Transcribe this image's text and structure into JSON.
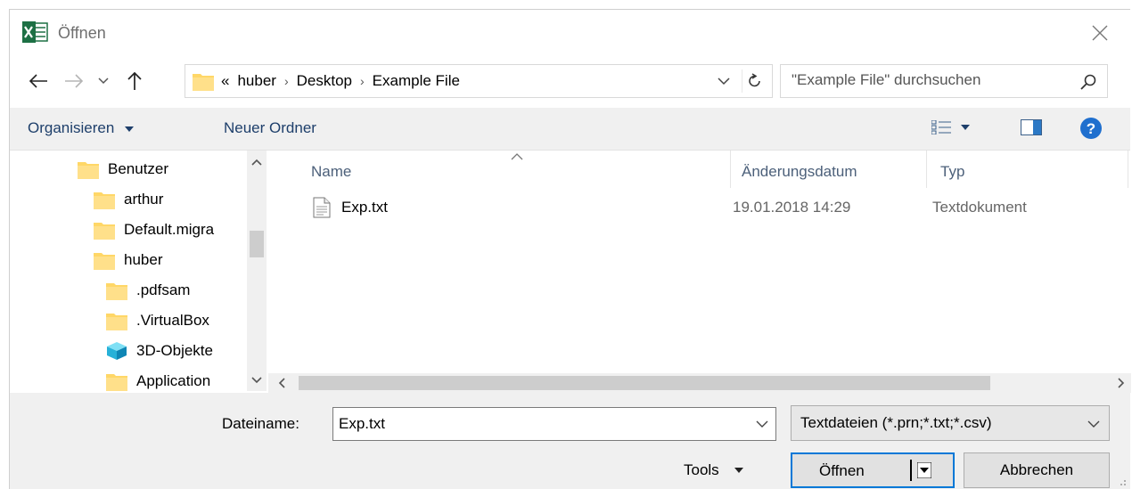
{
  "window": {
    "title": "Öffnen",
    "app_icon": "excel-icon",
    "close_icon": "close-icon"
  },
  "nav": {
    "back_icon": "arrow-left-icon",
    "forward_icon": "arrow-right-icon",
    "recent_icon": "chevron-down-icon",
    "up_icon": "arrow-up-icon",
    "overflow": "«",
    "breadcrumbs": [
      "huber",
      "Desktop",
      "Example File"
    ],
    "refresh_icon": "refresh-icon",
    "search_placeholder": "\"Example File\" durchsuchen",
    "search_icon": "search-icon"
  },
  "toolbar": {
    "organize_label": "Organisieren",
    "new_folder_label": "Neuer Ordner",
    "view_icon": "view-options-icon",
    "preview_icon": "preview-pane-icon",
    "help_icon": "help-icon"
  },
  "tree": {
    "items": [
      {
        "label": "Benutzer",
        "icon": "folder-icon",
        "indent": 1
      },
      {
        "label": "arthur",
        "icon": "folder-icon",
        "indent": 2
      },
      {
        "label": "Default.migra",
        "icon": "folder-icon",
        "indent": 2
      },
      {
        "label": "huber",
        "icon": "folder-icon",
        "indent": 2
      },
      {
        "label": ".pdfsam",
        "icon": "folder-icon",
        "indent": 3
      },
      {
        "label": ".VirtualBox",
        "icon": "folder-icon",
        "indent": 3
      },
      {
        "label": "3D-Objekte",
        "icon": "3d-objects-icon",
        "indent": 3
      },
      {
        "label": "Application",
        "icon": "folder-icon",
        "indent": 3
      }
    ]
  },
  "files": {
    "columns": [
      "Name",
      "Änderungsdatum",
      "Typ"
    ],
    "rows": [
      {
        "name": "Exp.txt",
        "date": "19.01.2018 14:29",
        "type": "Textdokument",
        "icon": "text-file-icon"
      }
    ]
  },
  "bottom": {
    "filename_label": "Dateiname:",
    "filename_value": "Exp.txt",
    "filetype_value": "Textdateien (*.prn;*.txt;*.csv)",
    "tools_label": "Tools",
    "open_label": "Öffnen",
    "cancel_label": "Abbrechen"
  },
  "colors": {
    "accent": "#0078d7",
    "folder": "#ffd767",
    "toolbar_bg": "#f0f0f0",
    "excel_green": "#1d7044"
  }
}
